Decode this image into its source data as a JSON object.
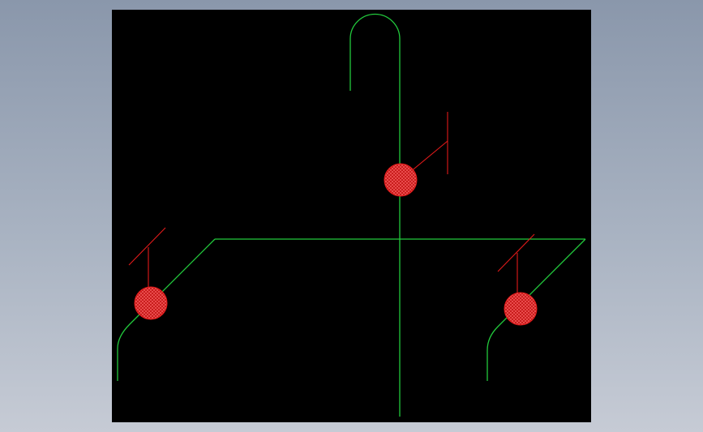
{
  "viewer": {
    "background_color": "#000000",
    "surround_gradient": [
      "#8a97ab",
      "#c6cbd5"
    ]
  },
  "drawing": {
    "rebar_color": "#22c93c",
    "section_color": "#e21a1a",
    "hatch_color": "#ff6a6a"
  }
}
